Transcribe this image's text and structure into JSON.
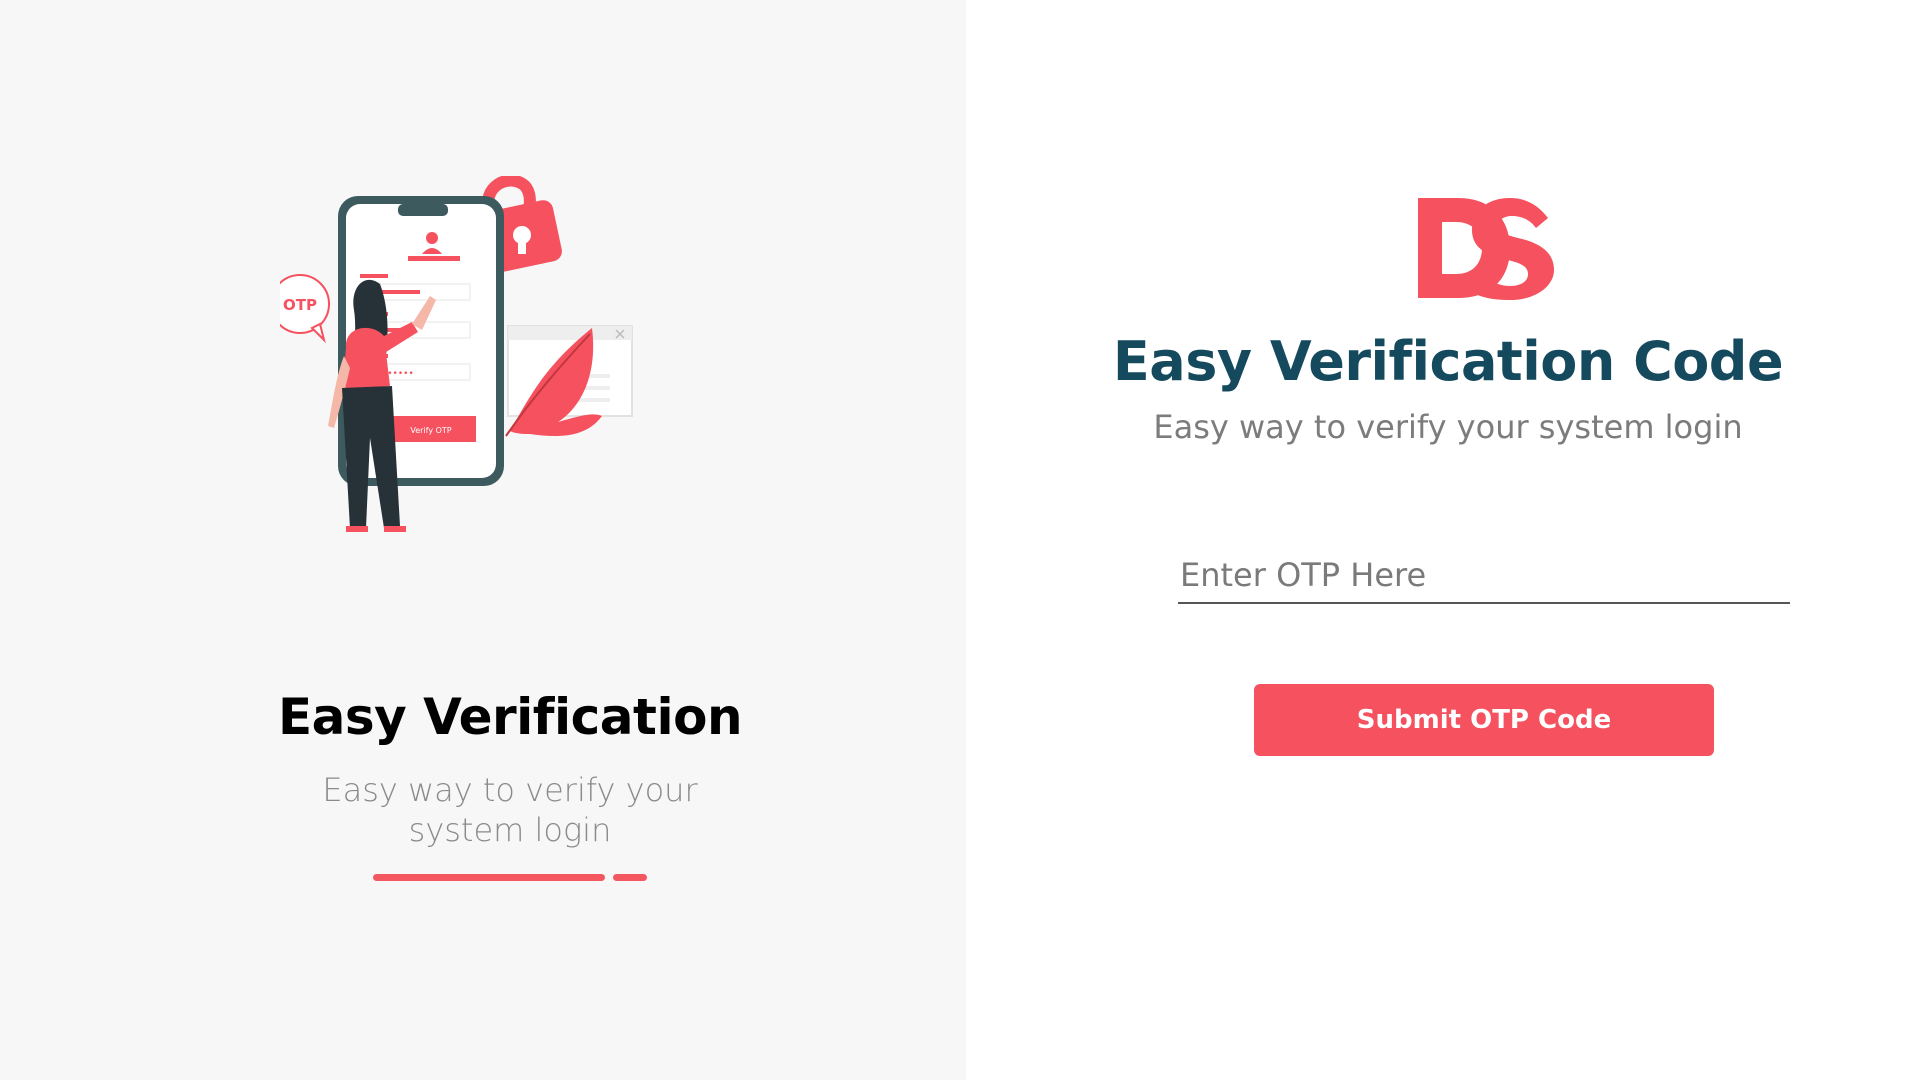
{
  "colors": {
    "accent": "#f5515f",
    "title_dark": "#154a5e",
    "phone_frame": "#3d5a5e",
    "figure_dark": "#263238",
    "left_bg": "#f7f7f7"
  },
  "left": {
    "title": "Easy Verification",
    "subtitle": "Easy way to verify your system login",
    "illustration": {
      "bubble_text": "OTP",
      "phone_button_label": "Verify OTP",
      "password_mask": "•••••••••"
    },
    "progress": {
      "active_index": 0,
      "segments": 2
    }
  },
  "right": {
    "logo_text": "DS",
    "title": "Easy Verification Code",
    "subtitle": "Easy way to verify your system login",
    "otp_input": {
      "value": "",
      "placeholder": "Enter OTP Here"
    },
    "submit_label": "Submit OTP Code"
  }
}
